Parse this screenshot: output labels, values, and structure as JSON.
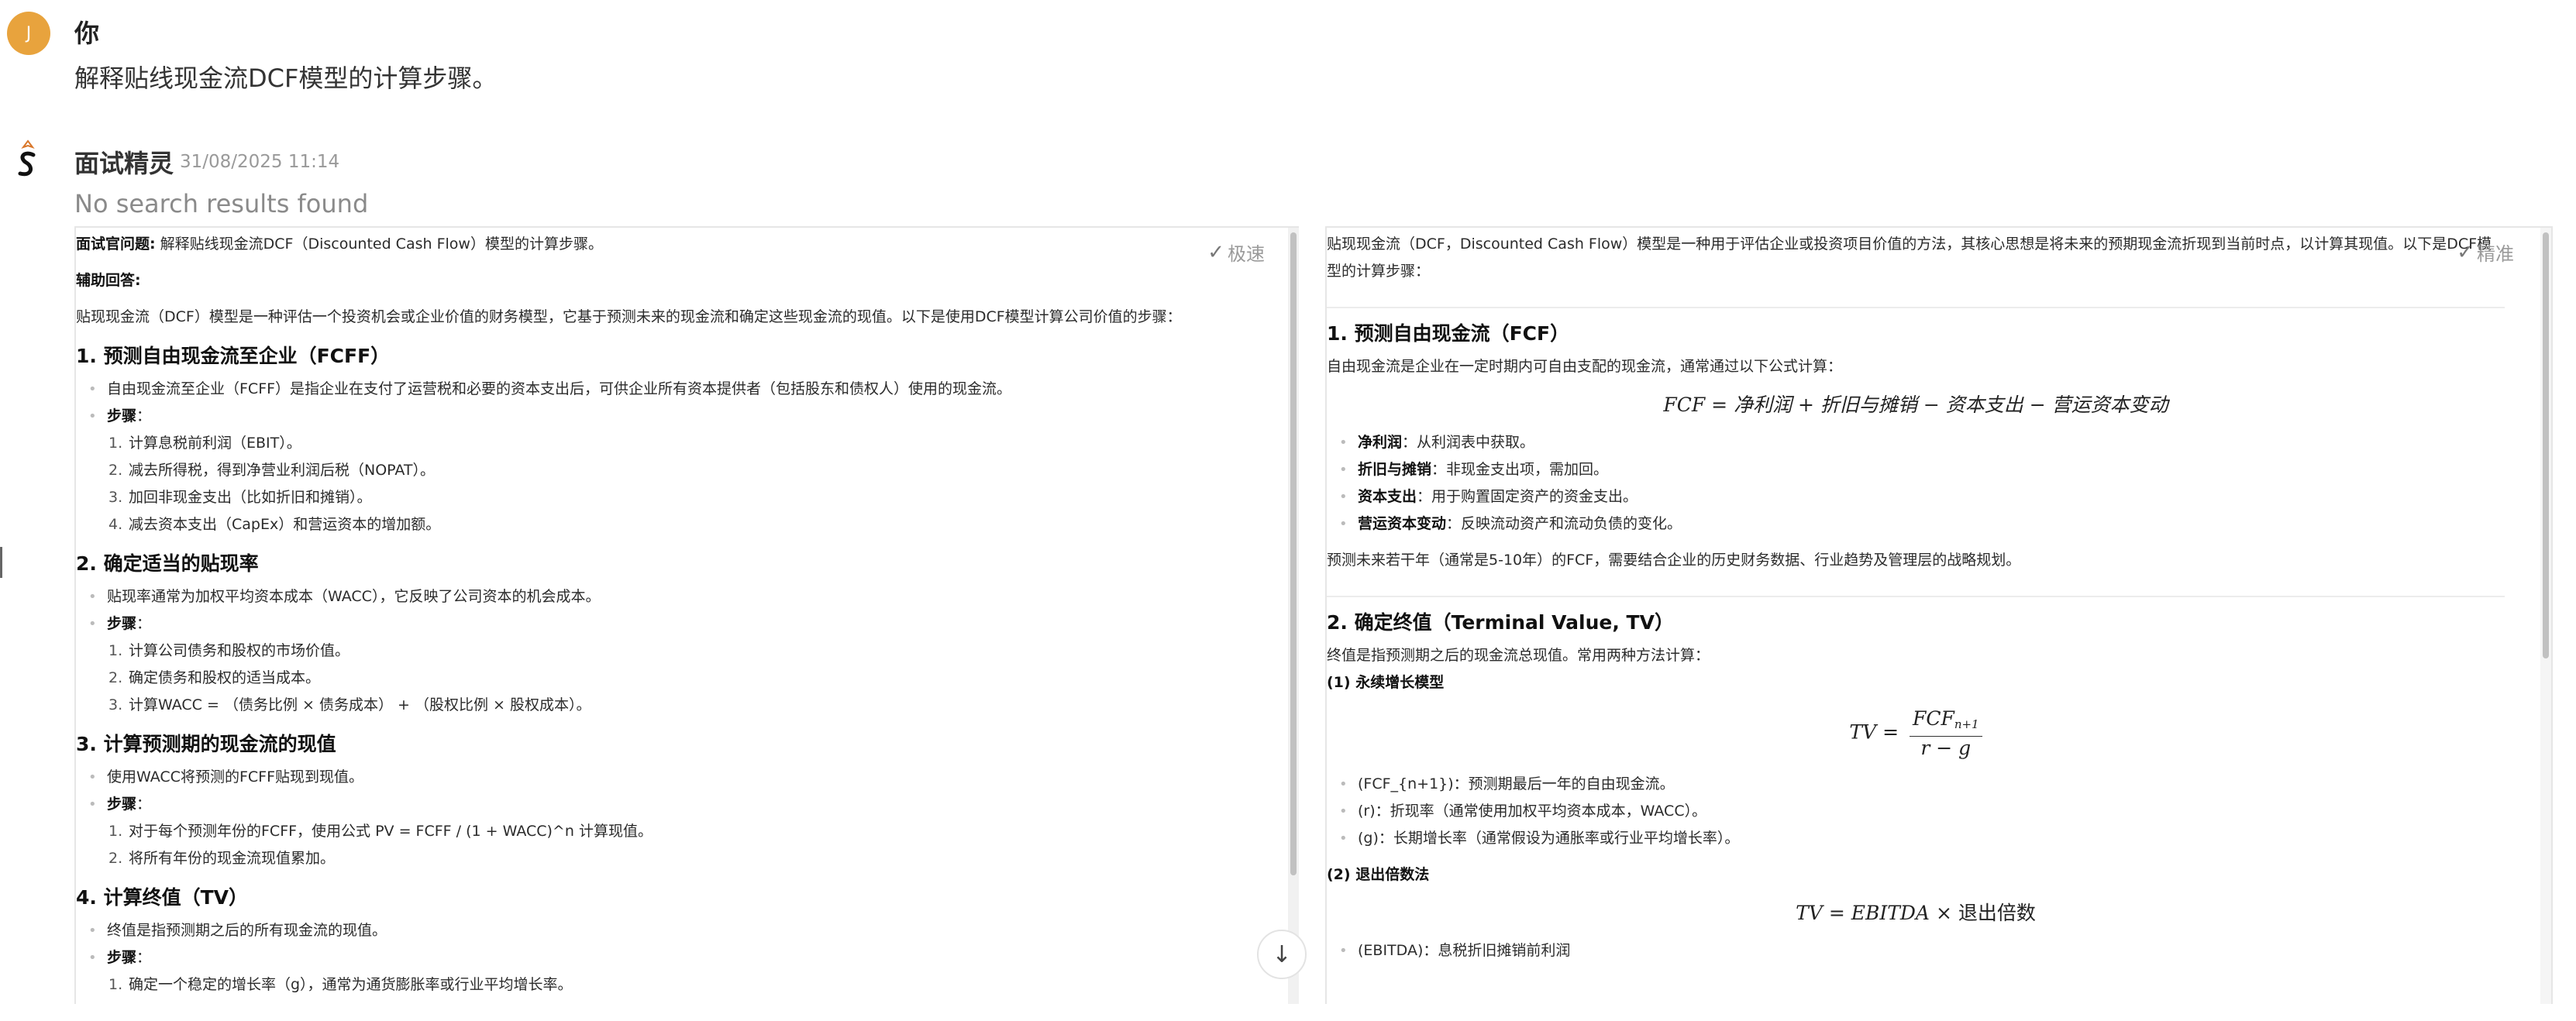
{
  "user": {
    "avatar_letter": "J",
    "name": "你",
    "message": "解释贴线现金流DCF模型的计算步骤。"
  },
  "bot": {
    "name": "面试精灵",
    "timestamp": "31/08/2025 11:14",
    "no_results": "No search results found"
  },
  "left_panel": {
    "badge": "极速",
    "question_label": "面试官问题:",
    "question_text": " 解释贴线现金流DCF（Discounted Cash Flow）模型的计算步骤。",
    "aux_label": "辅助回答:",
    "intro": "贴现现金流（DCF）模型是一种评估一个投资机会或企业价值的财务模型，它基于预测未来的现金流和确定这些现金流的现值。以下是使用DCF模型计算公司价值的步骤：",
    "s1_title": "1. 预测自由现金流至企业（FCFF）",
    "s1_bullet": "自由现金流至企业（FCFF）是指企业在支付了运营税和必要的资本支出后，可供企业所有资本提供者（包括股东和债权人）使用的现金流。",
    "steps_label": "步骤",
    "s1_steps": [
      "计算息税前利润（EBIT）。",
      "减去所得税，得到净营业利润后税（NOPAT）。",
      "加回非现金支出（比如折旧和摊销）。",
      "减去资本支出（CapEx）和营运资本的增加额。"
    ],
    "s2_title": "2. 确定适当的贴现率",
    "s2_bullet": "贴现率通常为加权平均资本成本（WACC），它反映了公司资本的机会成本。",
    "s2_steps": [
      "计算公司债务和股权的市场价值。",
      "确定债务和股权的适当成本。",
      "计算WACC = （债务比例 × 债务成本） + （股权比例 × 股权成本）。"
    ],
    "s3_title": "3. 计算预测期的现金流的现值",
    "s3_bullet": "使用WACC将预测的FCFF贴现到现值。",
    "s3_steps": [
      "对于每个预测年份的FCFF，使用公式 PV = FCFF / (1 + WACC)^n 计算现值。",
      "将所有年份的现金流现值累加。"
    ],
    "s4_title": "4. 计算终值（TV）",
    "s4_bullet": "终值是指预测期之后的所有现金流的现值。",
    "s4_steps": [
      "确定一个稳定的增长率（g），通常为通货膨胀率或行业平均增长率。"
    ]
  },
  "right_panel": {
    "badge": "精准",
    "intro": "贴现现金流（DCF，Discounted Cash Flow）模型是一种用于评估企业或投资项目价值的方法，其核心思想是将未来的预期现金流折现到当前时点，以计算其现值。以下是DCF模型的计算步骤：",
    "s1_title": "1. 预测自由现金流（FCF）",
    "s1_desc": "自由现金流是企业在一定时期内可自由支配的现金流，通常通过以下公式计算：",
    "s1_formula": "FCF = 净利润 + 折旧与摊销 − 资本支出 − 营运资本变动",
    "s1_items": [
      {
        "term": "净利润",
        "desc": "：从利润表中获取。"
      },
      {
        "term": "折旧与摊销",
        "desc": "：非现金支出项，需加回。"
      },
      {
        "term": "资本支出",
        "desc": "：用于购置固定资产的资金支出。"
      },
      {
        "term": "营运资本变动",
        "desc": "：反映流动资产和流动负债的变化。"
      }
    ],
    "s1_note": "预测未来若干年（通常是5-10年）的FCF，需要结合企业的历史财务数据、行业趋势及管理层的战略规划。",
    "s2_title": "2. 确定终值（Terminal Value, TV）",
    "s2_desc": "终值是指预测期之后的现金流总现值。常用两种方法计算：",
    "s2_m1": "(1) 永续增长模型",
    "s2_m1_items": [
      "(FCF_{n+1})：预测期最后一年的自由现金流。",
      "(r)：折现率（通常使用加权平均资本成本，WACC）。",
      "(g)：长期增长率（通常假设为通胀率或行业平均增长率）。"
    ],
    "s2_m2": "(2) 退出倍数法",
    "s2_m2_formula_tail": "退出倍数",
    "s2_m2_items": [
      "(EBITDA)：息税折旧摊销前利润"
    ]
  }
}
